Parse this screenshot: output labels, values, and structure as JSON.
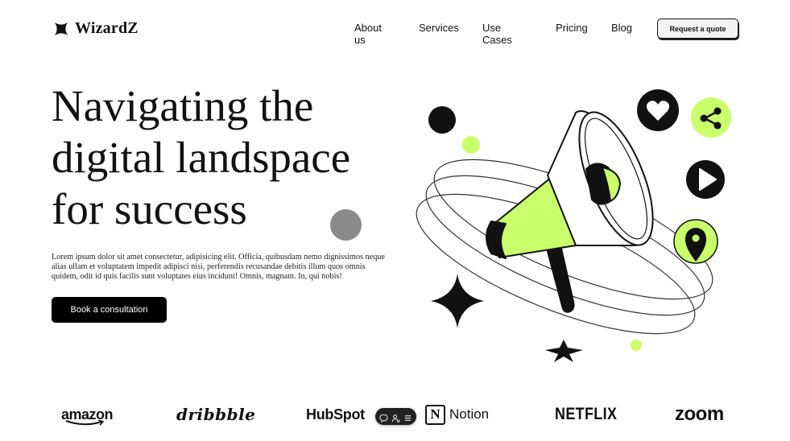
{
  "brand": {
    "name": "WizardZ",
    "logo_icon": "four-point-star-icon"
  },
  "nav": {
    "items": [
      "About us",
      "Services",
      "Use Cases",
      "Pricing",
      "Blog"
    ],
    "cta_label": "Request a quote"
  },
  "hero": {
    "title": "Navigating the digital landspace for success",
    "description": "Lorem ipsum dolor sit amet consectetur, adipisicing elit. Officia, quibusdam nemo dignissimos neque alias ullam et voluptatem impedit adipisci nisi, perferendis recusandae debitis illum quos omnis quidem, odit id quis facilis sunt voluptates eius incidunt! Omnis, magnam. In, qui nobis!",
    "cta_label": "Book a consultation"
  },
  "illustration": {
    "icons": [
      "megaphone-icon",
      "heart-icon",
      "share-icon",
      "play-icon",
      "location-pin-icon",
      "sparkle-star-icon"
    ]
  },
  "logos": {
    "amazon": "amazon",
    "dribbble": "dribbble",
    "hubspot": "HubSpot",
    "notion_mark": "N",
    "notion": "Notion",
    "netflix": "NETFLIX",
    "zoom": "zoom"
  },
  "floating_toolbar": {
    "icons": [
      "chat-bubble-icon",
      "user-settings-icon",
      "menu-icon"
    ]
  },
  "colors": {
    "accent": "#c8ff6a",
    "dark": "#111111",
    "gray_dot": "#8a8a8a"
  }
}
